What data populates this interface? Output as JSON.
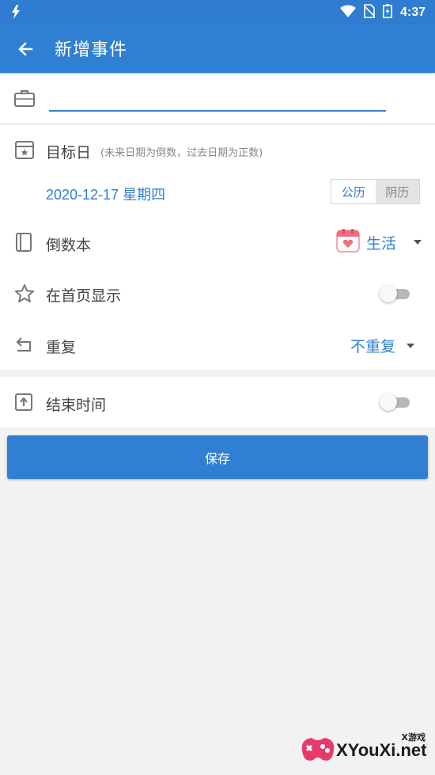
{
  "status_bar": {
    "time": "4:37"
  },
  "app_bar": {
    "title": "新增事件"
  },
  "title_input": {
    "value": "",
    "placeholder": ""
  },
  "target_date": {
    "label": "目标日",
    "hint": "(未来日期为倒数，过去日期为正数)",
    "value": "2020-12-17 星期四",
    "calendar_options": [
      "公历",
      "阴历"
    ],
    "selected_calendar": "公历"
  },
  "book": {
    "label": "倒数本",
    "value": "生活"
  },
  "show_on_home": {
    "label": "在首页显示",
    "enabled": false
  },
  "repeat": {
    "label": "重复",
    "value": "不重复"
  },
  "end_time": {
    "label": "结束时间",
    "enabled": false
  },
  "save_button": {
    "label": "保存"
  },
  "watermark": {
    "small": "X游戏",
    "text": "XYouXi.net"
  },
  "colors": {
    "primary": "#2f7fd3",
    "background": "#f3f2f2"
  }
}
